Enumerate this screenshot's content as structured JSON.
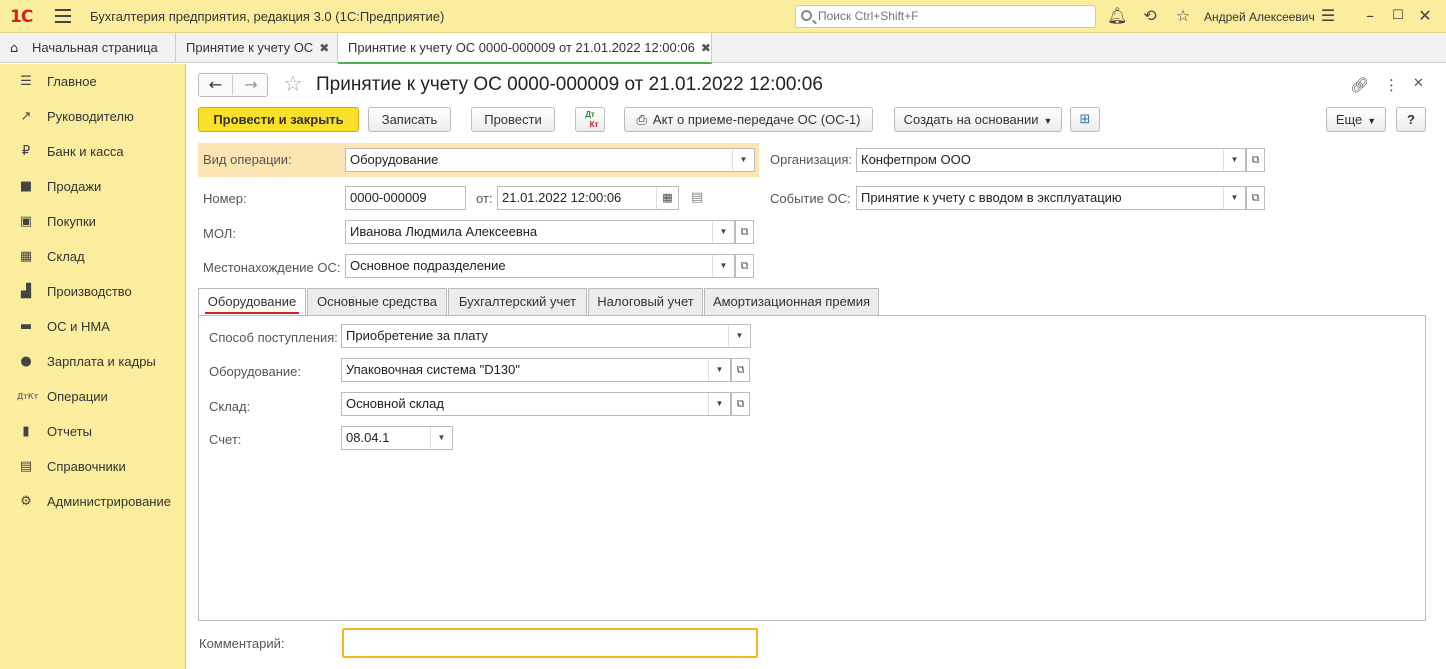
{
  "window": {
    "logo": "1С",
    "title": "Бухгалтерия предприятия, редакция 3.0  (1С:Предприятие)",
    "search_placeholder": "Поиск Ctrl+Shift+F",
    "user": "Андрей Алексеевич"
  },
  "tabs": [
    {
      "label": "Начальная страница"
    },
    {
      "label": "Принятие к учету ОС"
    },
    {
      "label": "Принятие к учету ОС 0000-000009 от 21.01.2022 12:00:06"
    }
  ],
  "sidebar": {
    "items": [
      {
        "label": "Главное",
        "icon": "menu-icon"
      },
      {
        "label": "Руководителю",
        "icon": "trend-icon"
      },
      {
        "label": "Банк и касса",
        "icon": "ruble-icon"
      },
      {
        "label": "Продажи",
        "icon": "bag-icon"
      },
      {
        "label": "Покупки",
        "icon": "cart-icon"
      },
      {
        "label": "Склад",
        "icon": "warehouse-icon"
      },
      {
        "label": "Производство",
        "icon": "factory-icon"
      },
      {
        "label": "ОС и НМА",
        "icon": "truck-icon"
      },
      {
        "label": "Зарплата и кадры",
        "icon": "person-icon"
      },
      {
        "label": "Операции",
        "icon": "dt-kt-icon"
      },
      {
        "label": "Отчеты",
        "icon": "bar-chart-icon"
      },
      {
        "label": "Справочники",
        "icon": "book-icon"
      },
      {
        "label": "Администрирование",
        "icon": "gear-icon"
      }
    ]
  },
  "document": {
    "title": "Принятие к учету ОС 0000-000009 от 21.01.2022 12:00:06"
  },
  "toolbar": {
    "post_close": "Провести и закрыть",
    "save": "Записать",
    "post": "Провести",
    "dtkt_top": "Дт",
    "dtkt_bottom": "Кт",
    "act": "Акт о приеме-передаче ОС (ОС-1)",
    "create_based": "Создать на основании",
    "more": "Еще",
    "help": "?"
  },
  "form": {
    "op_type_label": "Вид операции:",
    "op_type_value": "Оборудование",
    "org_label": "Организация:",
    "org_value": "Конфетпром ООО",
    "number_label": "Номер:",
    "number_value": "0000-000009",
    "date_label": "от:",
    "date_value": "21.01.2022 12:00:06",
    "event_label": "Событие ОС:",
    "event_value": "Принятие к учету с вводом в эксплуатацию",
    "mol_label": "МОЛ:",
    "mol_value": "Иванова Людмила Алексеевна",
    "location_label": "Местонахождение ОС:",
    "location_value": "Основное подразделение"
  },
  "form_tabs": [
    {
      "label": "Оборудование"
    },
    {
      "label": "Основные средства"
    },
    {
      "label": "Бухгалтерский учет"
    },
    {
      "label": "Налоговый учет"
    },
    {
      "label": "Амортизационная премия"
    }
  ],
  "equipment_tab": {
    "receipt_label": "Способ поступления:",
    "receipt_value": "Приобретение за плату",
    "equipment_label": "Оборудование:",
    "equipment_value": "Упаковочная система \"D130\"",
    "warehouse_label": "Склад:",
    "warehouse_value": "Основной склад",
    "account_label": "Счет:",
    "account_value": "08.04.1"
  },
  "comment": {
    "label": "Комментарий:",
    "value": ""
  }
}
